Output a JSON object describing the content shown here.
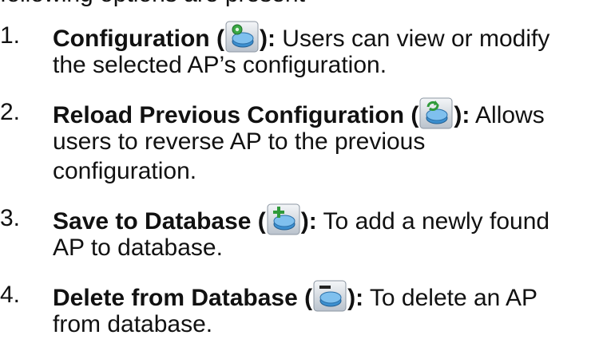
{
  "cut_line": "following options are present",
  "items": [
    {
      "number": "1.",
      "title": "Configuration (",
      "title_close": "):",
      "desc_line1": " Users can view or modify",
      "desc_line2": "the selected AP’s configuration.",
      "icon": "config-gear-icon"
    },
    {
      "number": "2.",
      "title": "Reload Previous Configuration (",
      "title_close": "):",
      "desc_line1": " Allows",
      "desc_line2": "users to reverse AP to the previous",
      "desc_line3": "configuration.",
      "icon": "reload-arrows-icon"
    },
    {
      "number": "3.",
      "title": "Save to Database (",
      "title_close": "):",
      "desc_line1": " To add a newly found",
      "desc_line2": "AP to database.",
      "icon": "add-plus-icon"
    },
    {
      "number": "4.",
      "title": "Delete from Database (",
      "title_close": "):",
      "desc_line1": " To delete an AP",
      "desc_line2": "from database.",
      "icon": "delete-minus-icon"
    }
  ]
}
